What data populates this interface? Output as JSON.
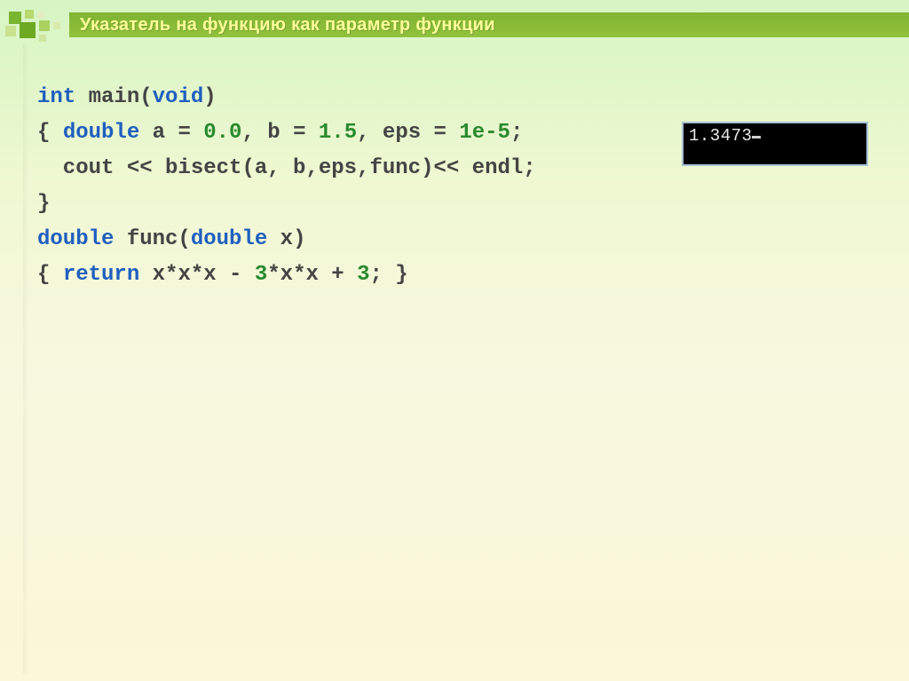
{
  "header": {
    "title": "Указатель на функцию как параметр функции"
  },
  "code": {
    "line1_kw1": "int",
    "line1_ident": " main(",
    "line1_kw2": "void",
    "line1_close": ")",
    "line2_open": "{ ",
    "line2_kw": "double",
    "line2_a": " a = ",
    "line2_v0": "0.0",
    "line2_comma1": ", b = ",
    "line2_v1": "1.5",
    "line2_comma2": ", eps = ",
    "line2_v2": "1e-5",
    "line2_semi": ";",
    "line3": "  cout << bisect(a, b,eps,func)<< endl;",
    "line4": "}",
    "blank": "",
    "line5_kw1": "double",
    "line5_ident": " func(",
    "line5_kw2": "double",
    "line5_close": " x)",
    "line6_open": "{ ",
    "line6_kw": "return",
    "line6_expr1": " x*x*x - ",
    "line6_n1": "3",
    "line6_expr2": "*x*x + ",
    "line6_n2": "3",
    "line6_semi": "; }"
  },
  "console": {
    "output": "1.3473"
  }
}
